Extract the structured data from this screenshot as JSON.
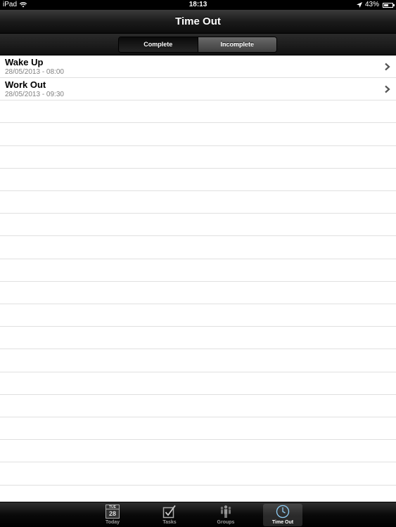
{
  "status_bar": {
    "device": "iPad",
    "time": "18:13",
    "battery": "43%",
    "battery_level": 0.43
  },
  "nav_bar": {
    "title": "Time Out"
  },
  "segmented_control": {
    "segments": [
      {
        "label": "Complete",
        "selected": true
      },
      {
        "label": "Incomplete",
        "selected": false
      }
    ]
  },
  "tasks": [
    {
      "title": "Wake Up",
      "subtitle": "28/05/2013 - 08:00"
    },
    {
      "title": "Work Out",
      "subtitle": "28/05/2013 - 09:30"
    }
  ],
  "tab_bar": {
    "tabs": [
      {
        "label": "Today",
        "icon": "calendar-icon",
        "calendar_day": "TUE",
        "calendar_date": "28",
        "active": false
      },
      {
        "label": "Tasks",
        "icon": "checkbox-icon",
        "active": false
      },
      {
        "label": "Groups",
        "icon": "people-icon",
        "active": false
      },
      {
        "label": "Time Out",
        "icon": "clock-icon",
        "active": true
      }
    ]
  },
  "colors": {
    "nav_background": "#1b1b1b",
    "subtitle_text": "#808080",
    "separator": "#e0e0e0"
  }
}
